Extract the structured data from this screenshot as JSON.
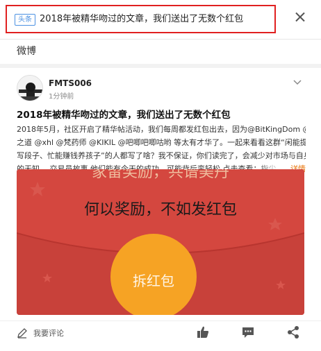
{
  "notification": {
    "tag": "头条",
    "title": "2018年被精华吻过的文章，我们送出了无数个红包"
  },
  "section": {
    "title": "微博"
  },
  "post": {
    "author": "FMTS006",
    "time": "1分钟前",
    "title": "2018年被精华吻过的文章，我们送出了无数个红包",
    "body_lines": [
      "2018年5月，社区开启了精华帖活动，我们每周都发红包出去，因为@BitKingDom @反",
      "之道 @xhl @梵药师 @KIKIL @吧唧吧唧咕哟 等太有才华了。一起来看看这群“闲能提笔",
      "写段子、忙能赚钱养孩子”的人都写了啥？我不保证，你们读完了，会减少对市场与自身",
      "的无知。 交易员故事 他们能有今天的成功，可能背后蛮轻松 点击查看：指尖"
    ],
    "more_label": "详情"
  },
  "image": {
    "top_text": "家留奖励，共谱美丹",
    "caption": "何以奖励，不如发红包",
    "button_label": "拆红包"
  },
  "actions": {
    "comment_label": "我要评论"
  },
  "colors": {
    "red_box": "#e02020",
    "red_envelope": "#c8413a",
    "gold": "#f6a324",
    "link": "#e8750a",
    "tag_blue": "#4a90e2"
  }
}
